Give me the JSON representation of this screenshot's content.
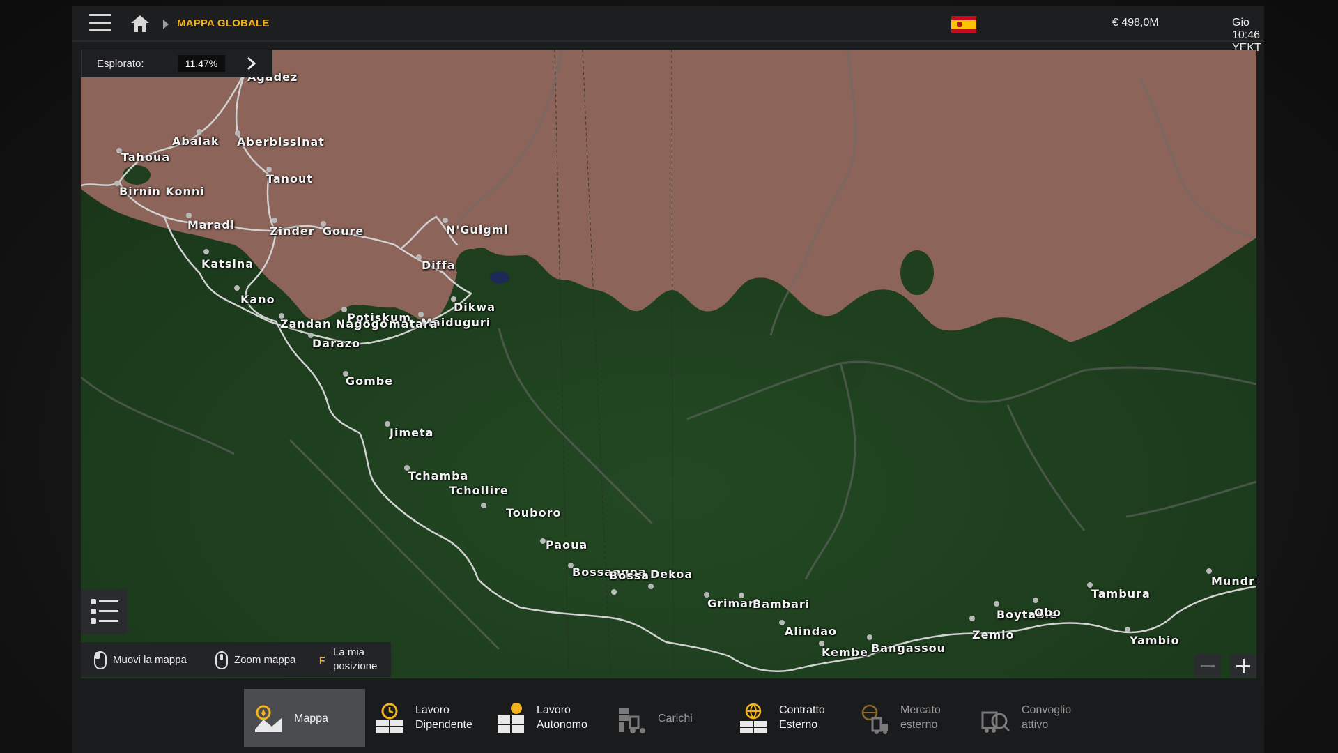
{
  "topbar": {
    "breadcrumb": "MAPPA GLOBALE",
    "money": "€ 498,0M",
    "clock": "Gio 10:46 YEKT",
    "icons": [
      "menu-icon",
      "home-icon",
      "flag-spain-icon"
    ]
  },
  "explored": {
    "label": "Esplorato:",
    "value": "11.47%"
  },
  "map": {
    "cities": [
      {
        "name": "Agadez"
      },
      {
        "name": "Abalak"
      },
      {
        "name": "Aberbissinat"
      },
      {
        "name": "Tahoua"
      },
      {
        "name": "Tanout"
      },
      {
        "name": "Birnin Konni"
      },
      {
        "name": "Maradi"
      },
      {
        "name": "Zinder"
      },
      {
        "name": "Goure"
      },
      {
        "name": "N'Guigmi"
      },
      {
        "name": "Katsina"
      },
      {
        "name": "Diffa"
      },
      {
        "name": "Kano"
      },
      {
        "name": "Dikwa"
      },
      {
        "name": "Potiskum"
      },
      {
        "name": "Maiduguri"
      },
      {
        "name": "Zandan Nagogo"
      },
      {
        "name": "matara"
      },
      {
        "name": "Darazo"
      },
      {
        "name": "Gombe"
      },
      {
        "name": "Jimeta"
      },
      {
        "name": "Tchamba"
      },
      {
        "name": "Tchollire"
      },
      {
        "name": "Touboro"
      },
      {
        "name": "Paoua"
      },
      {
        "name": "Bossangoa"
      },
      {
        "name": "Bossa"
      },
      {
        "name": "Dekoa"
      },
      {
        "name": "Grimari"
      },
      {
        "name": "Bambari"
      },
      {
        "name": "Alindao"
      },
      {
        "name": "Kembe"
      },
      {
        "name": "Bangassou"
      },
      {
        "name": "Zemio"
      },
      {
        "name": "Boytable"
      },
      {
        "name": "Obo"
      },
      {
        "name": "Tambura"
      },
      {
        "name": "Yambio"
      },
      {
        "name": "Mundri"
      }
    ]
  },
  "hints": {
    "move": "Muovi la mappa",
    "zoom": "Zoom mappa",
    "position_key": "F",
    "position_line1": "La mia",
    "position_line2": "posizione"
  },
  "tabs": [
    {
      "line1": "Mappa",
      "line2": "",
      "icon": "map-pin-icon",
      "active": true
    },
    {
      "line1": "Lavoro",
      "line2": "Dipendente",
      "icon": "clock-boxes-icon"
    },
    {
      "line1": "Lavoro",
      "line2": "Autonomo",
      "icon": "sun-boxes-icon"
    },
    {
      "line1": "Carichi",
      "line2": "",
      "icon": "forklift-icon",
      "dim": true
    },
    {
      "line1": "Contratto",
      "line2": "Esterno",
      "icon": "globe-boxes-icon"
    },
    {
      "line1": "Mercato",
      "line2": "esterno",
      "icon": "globe-truck-icon",
      "dim": true
    },
    {
      "line1": "Convoglio",
      "line2": "attivo",
      "icon": "convoy-icon",
      "dim": true
    }
  ],
  "colors": {
    "accent": "#f2b21c",
    "desert": "#8c6459",
    "forest": "#1f3f1f",
    "road": "#c7c7c7"
  }
}
